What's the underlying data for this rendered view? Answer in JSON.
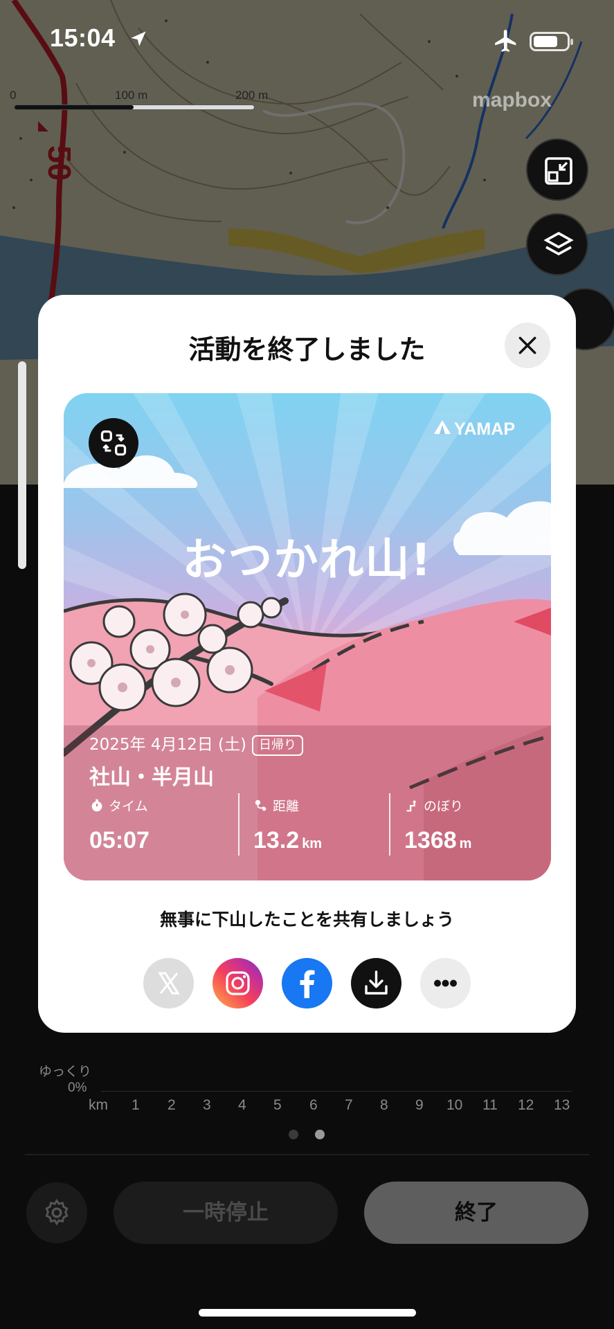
{
  "status_bar": {
    "time": "15:04"
  },
  "map": {
    "scale_labels": [
      "0",
      "100 m",
      "200 m"
    ],
    "attribution": "mapbox",
    "road_label": "50"
  },
  "modal": {
    "title": "活動を終了しました",
    "card": {
      "headline": "おつかれ山!",
      "brand": "YAMAP",
      "date": "2025年 4月12日 (土)",
      "trip_type": "日帰り",
      "mountain": "社山・半月山",
      "stats": [
        {
          "label": "タイム",
          "value": "05:07",
          "unit": ""
        },
        {
          "label": "距離",
          "value": "13.2",
          "unit": "km"
        },
        {
          "label": "のぼり",
          "value": "1368",
          "unit": "m"
        }
      ]
    },
    "share_prompt": "無事に下山したことを共有しましょう",
    "share_targets": [
      "x",
      "instagram",
      "facebook",
      "download",
      "more"
    ]
  },
  "chart": {
    "y_labels": [
      "ゆっくり",
      "0%"
    ],
    "x_unit": "km",
    "x_ticks": [
      "1",
      "2",
      "3",
      "4",
      "5",
      "6",
      "7",
      "8",
      "9",
      "10",
      "11",
      "12",
      "13"
    ]
  },
  "controls": {
    "pause_label": "一時停止",
    "end_label": "終了"
  },
  "colors": {
    "brand_pink": "#e45b78",
    "instagram": "#e1306c",
    "facebook": "#1877f2"
  }
}
